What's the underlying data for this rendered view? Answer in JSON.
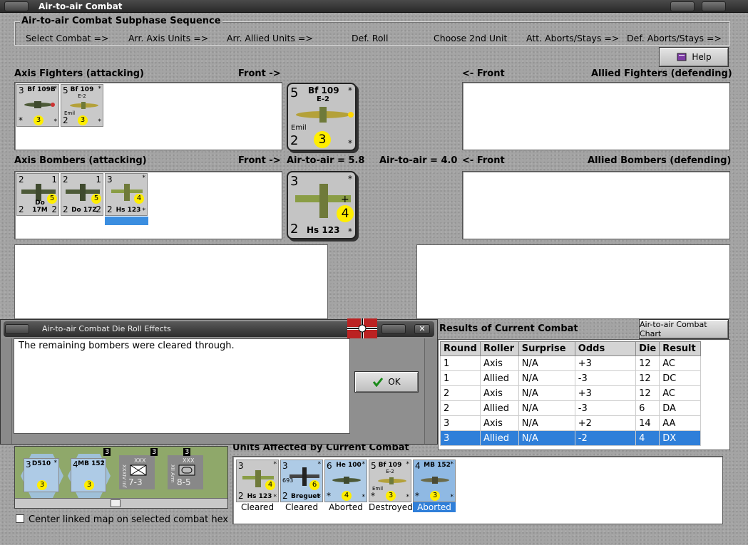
{
  "window": {
    "title": "Air-to-air Combat"
  },
  "sequence": {
    "title": "Air-to-air Combat Subphase Sequence",
    "steps": [
      "Select Combat =>",
      "Arr. Axis Units =>",
      "Arr. Allied Units =>",
      "Def. Roll",
      "Choose 2nd Unit",
      "Att. Aborts/Stays =>",
      "Def. Aborts/Stays =>"
    ]
  },
  "help_button": "Help",
  "axis_fighters": {
    "label": "Axis Fighters (attacking)",
    "front": "Front ->",
    "counters": [
      {
        "top_left": "3",
        "name": "Bf 109B",
        "top_right": "*",
        "bottom_left": "*",
        "circle": "3",
        "bottom_right": "*"
      },
      {
        "top_left": "5",
        "name": "Bf 109",
        "sub": "E-2",
        "top_right": "*",
        "emil": "Emil",
        "bottom_left": "2",
        "circle": "3",
        "bottom_right": "*"
      }
    ]
  },
  "allied_fighters": {
    "label": "Allied Fighters (defending)",
    "front": "<- Front"
  },
  "big_fighter": {
    "top_left": "5",
    "name": "Bf 109",
    "sub": "E-2",
    "star_top": "*",
    "emil": "Emil",
    "bottom_left": "2",
    "circle": "3",
    "star_bottom": "*"
  },
  "axis_bombers": {
    "label": "Axis Bombers (attacking)",
    "front": "Front ->",
    "air_to_air": "Air-to-air = 5.8",
    "counters": [
      {
        "top_left": "2",
        "top_right": "1",
        "circle": "5",
        "bottom_left": "2",
        "name": "Do 17M",
        "bottom_right": "2"
      },
      {
        "top_left": "2",
        "top_right": "1",
        "circle": "5",
        "bottom_left": "2",
        "name": "Do 17Z",
        "bottom_right": "2"
      },
      {
        "top_left": "3",
        "top_right": "*",
        "circle": "4",
        "bottom_left": "2",
        "name": "Hs 123",
        "bottom_right": "*"
      }
    ]
  },
  "allied_bombers": {
    "label": "Allied Bombers (defending)",
    "front": "<- Front",
    "air_to_air": "Air-to-air = 4.0"
  },
  "big_bomber": {
    "top_left": "3",
    "star_top": "*",
    "circle": "4",
    "bottom_left": "2",
    "name": "Hs 123",
    "star_bottom": "*"
  },
  "dialog": {
    "title": "Air-to-air Combat Die Roll Effects",
    "message": "The remaining bombers were cleared through.",
    "ok": "OK"
  },
  "results": {
    "title": "Results of Current Combat",
    "chart_button": "Air-to-air Combat Chart",
    "columns": [
      "Round",
      "Roller",
      "Surprise",
      "Odds",
      "Die",
      "Result"
    ],
    "rows": [
      [
        "1",
        "Axis",
        "N/A",
        "+3",
        "12",
        "AC"
      ],
      [
        "1",
        "Allied",
        "N/A",
        "-3",
        "12",
        "DC"
      ],
      [
        "2",
        "Axis",
        "N/A",
        "+3",
        "12",
        "AC"
      ],
      [
        "2",
        "Allied",
        "N/A",
        "-3",
        "6",
        "DA"
      ],
      [
        "3",
        "Axis",
        "N/A",
        "+2",
        "14",
        "AA"
      ],
      [
        "3",
        "Allied",
        "N/A",
        "-2",
        "4",
        "DX"
      ]
    ],
    "selected_row": 5
  },
  "affected": {
    "title": "Units Affected by Current Combat",
    "units": [
      {
        "top_left": "3",
        "top_right": "*",
        "circle": "4",
        "bottom_left": "2",
        "name": "Hs 123",
        "bottom_right": "*",
        "status": "Cleared"
      },
      {
        "top_left": "3",
        "top_right": "*",
        "sub": "693",
        "circle": "6",
        "bottom_left": "2",
        "name": "Breguet",
        "bottom_right": "*",
        "status": "Cleared"
      },
      {
        "top_left": "6",
        "name": "He 100",
        "top_right": "*",
        "bottom_left": "*",
        "circle": "4",
        "bottom_right": "*",
        "status": "Aborted"
      },
      {
        "top_left": "5",
        "name": "Bf 109",
        "sub": "E-2",
        "top_right": "*",
        "emil": "Emil",
        "bottom_left": "*",
        "circle": "3",
        "bottom_right": "*",
        "status": "Destroyed"
      },
      {
        "top_left": "4",
        "name": "MB 152",
        "top_right": "*",
        "bottom_left": "*",
        "circle": "3",
        "bottom_right": "*",
        "status": "Aborted"
      }
    ]
  },
  "map": {
    "hexes": [
      {
        "top_left": "3",
        "name": "D510",
        "top_right": "*",
        "circle": "3"
      },
      {
        "top_left": "4",
        "name": "MB 152",
        "top_right": "*",
        "circle": "3"
      },
      {
        "label": "XXX",
        "value": "7-3",
        "side": "XXXIV Inf"
      },
      {
        "label": "XXX",
        "value": "8-5",
        "side": "XII Arm"
      }
    ],
    "numbers": [
      "3",
      "3",
      "3"
    ],
    "center_checkbox": "Center linked map on selected combat hex"
  }
}
